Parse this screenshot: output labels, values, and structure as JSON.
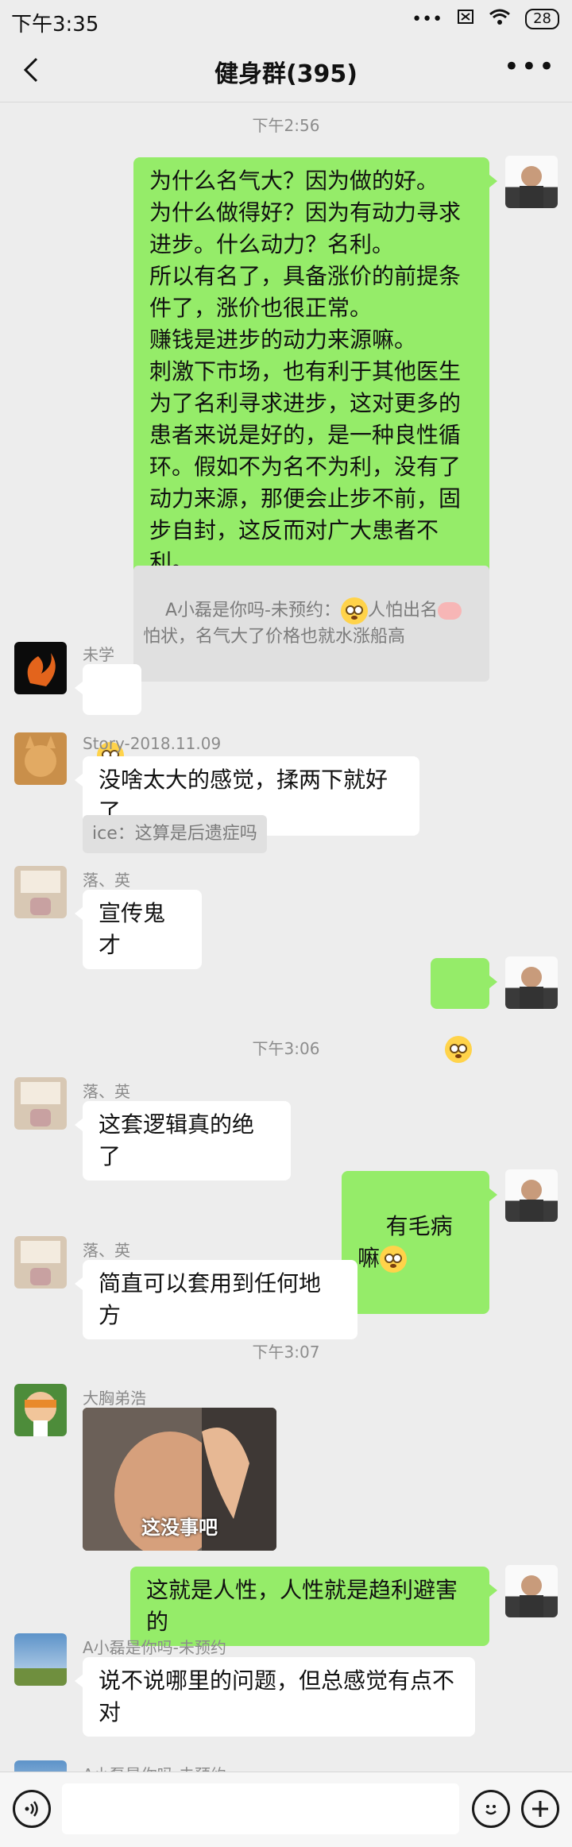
{
  "status": {
    "time": "下午3:35",
    "signal": "•••",
    "battery": "28"
  },
  "header": {
    "title": "健身群(395)"
  },
  "messages": {
    "ts1": "下午2:56",
    "m1_text": "为什么名气大？因为做的好。\n为什么做得好？因为有动力寻求进步。什么动力？名利。\n所以有名了，具备涨价的前提条件了，涨价也很正常。\n赚钱是进步的动力来源嘛。\n刺激下市场，也有利于其他医生为了名利寻求进步，这对更多的患者来说是好的，是一种良性循环。假如不为名不为利，没有了动力来源，那便会止步不前，固步自封，这反而对广大患者不利。",
    "q1_prefix": "A小磊是你吗-未预约：",
    "q1_mid": "人怕出名",
    "q1_suffix": " 怕状，名气大了价格也就水涨船高",
    "n2": "未学",
    "n3": "Story-2018.11.09",
    "m3_text": "没啥太大的感觉，揉两下就好了",
    "q3": "ice：这算是后遗症吗",
    "n4": "落、英",
    "m4_text": "宣传鬼才",
    "ts2": "下午3:06",
    "n6": "落、英",
    "m6_text": "这套逻辑真的绝了",
    "m7_text": "有毛病嘛",
    "n8": "落、英",
    "m8_text": "简直可以套用到任何地方",
    "ts3": "下午3:07",
    "n9": "大胸弟浩",
    "img_caption": "这没事吧",
    "m10_text": "这就是人性，人性就是趋利避害的",
    "n11": "A小磊是你吗-未预约",
    "m11_text": "说不说哪里的问题，但总感觉有点不对",
    "n12": "A小磊是你吗-未预约"
  },
  "colors": {
    "background": "#ededed",
    "self_bubble": "#95ec69",
    "other_bubble": "#ffffff"
  },
  "icons": [
    "back-icon",
    "more-icon",
    "voice-icon",
    "emoji-icon",
    "plus-icon"
  ]
}
